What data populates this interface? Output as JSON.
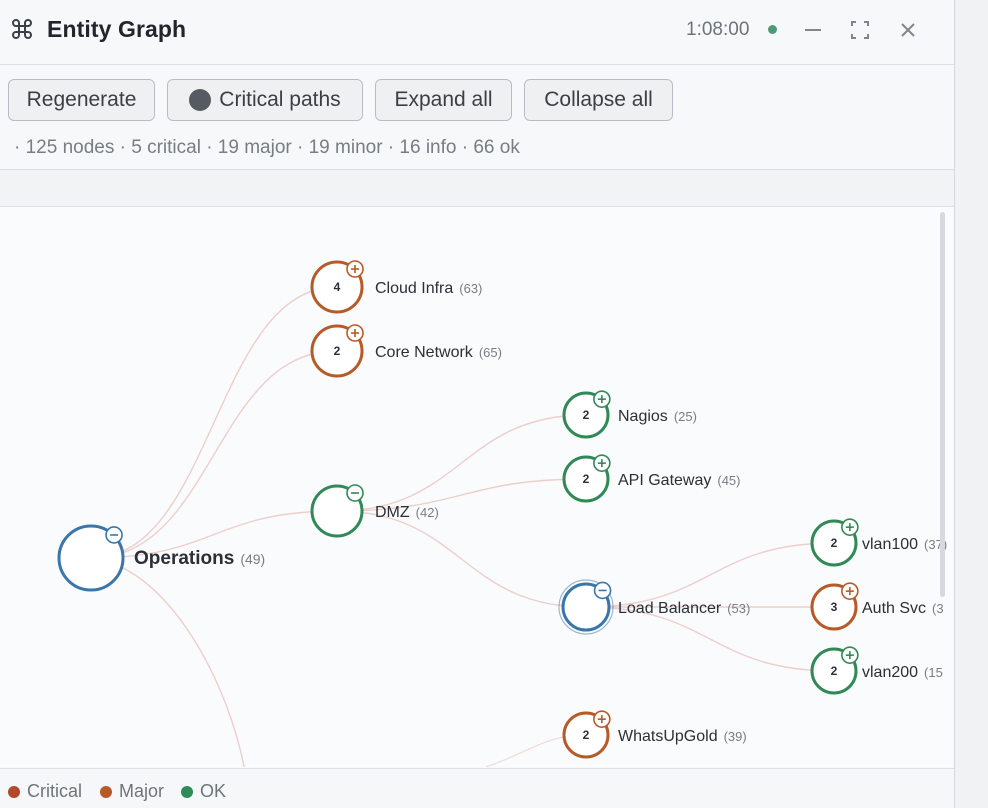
{
  "window": {
    "title": "Entity Graph",
    "time": "1:08:00",
    "status_color": "#4e9a78"
  },
  "toolbar": {
    "regenerate_label": "Regenerate",
    "critical_paths_label": "Critical paths",
    "expand_all_label": "Expand all",
    "collapse_all_label": "Collapse all",
    "summary": "· 125 nodes · 5 critical · 19 major · 19 minor · 16 info · 66 ok"
  },
  "colors": {
    "major": "#b85a28",
    "ok": "#2f8a55",
    "root": "#3a76a8",
    "edge": "#e8c4bf"
  },
  "graph": {
    "nodes": [
      {
        "id": "operations",
        "label": "Operations",
        "count": "(49)",
        "badge": "",
        "status": "root",
        "toggle": "minus"
      },
      {
        "id": "cloud-infra",
        "label": "Cloud Infra",
        "count": "(63)",
        "badge": "4",
        "status": "major",
        "toggle": "plus"
      },
      {
        "id": "core-network",
        "label": "Core Network",
        "count": "(65)",
        "badge": "2",
        "status": "major",
        "toggle": "plus"
      },
      {
        "id": "dmz",
        "label": "DMZ",
        "count": "(42)",
        "badge": "",
        "status": "ok",
        "toggle": "minus"
      },
      {
        "id": "nagios",
        "label": "Nagios",
        "count": "(25)",
        "badge": "2",
        "status": "ok",
        "toggle": "plus"
      },
      {
        "id": "api-gateway",
        "label": "API Gateway",
        "count": "(45)",
        "badge": "2",
        "status": "ok",
        "toggle": "plus"
      },
      {
        "id": "load-balancer",
        "label": "Load Balancer",
        "count": "(53)",
        "badge": "",
        "status": "root",
        "toggle": "minus"
      },
      {
        "id": "vlan100",
        "label": "vlan100",
        "count": "(37)",
        "badge": "2",
        "status": "ok",
        "toggle": "plus"
      },
      {
        "id": "auth-svc",
        "label": "Auth Svc",
        "count": "(3",
        "badge": "3",
        "status": "major",
        "toggle": "plus"
      },
      {
        "id": "vlan200",
        "label": "vlan200",
        "count": "(15",
        "badge": "2",
        "status": "ok",
        "toggle": "plus"
      },
      {
        "id": "whatsupgold",
        "label": "WhatsUpGold",
        "count": "(39)",
        "badge": "2",
        "status": "major",
        "toggle": "plus"
      }
    ],
    "edges": [
      [
        "operations",
        "cloud-infra"
      ],
      [
        "operations",
        "core-network"
      ],
      [
        "operations",
        "dmz"
      ],
      [
        "dmz",
        "nagios"
      ],
      [
        "dmz",
        "api-gateway"
      ],
      [
        "dmz",
        "load-balancer"
      ],
      [
        "load-balancer",
        "vlan100"
      ],
      [
        "load-balancer",
        "auth-svc"
      ],
      [
        "load-balancer",
        "vlan200"
      ]
    ]
  },
  "legend": [
    {
      "label": "Critical",
      "color": "#b5482a"
    },
    {
      "label": "Major",
      "color": "#b85a28"
    },
    {
      "label": "OK",
      "color": "#2f8a55"
    }
  ],
  "icons": {
    "title": "command-icon",
    "minimize": "minimize-icon",
    "maximize": "maximize-icon",
    "close": "close-icon"
  }
}
